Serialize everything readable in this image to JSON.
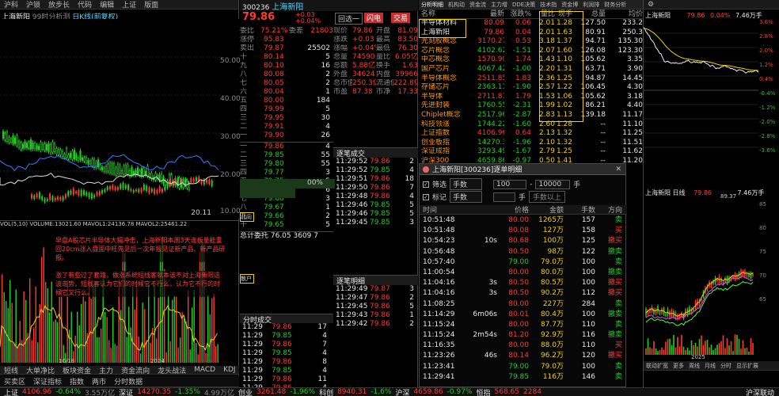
{
  "left": {
    "tabs": [
      "沪科",
      "沪锁",
      "放步长",
      "代码",
      "编辑",
      "上证",
      "版面",
      "买卖区",
      "深证指标",
      "指数",
      "两市",
      "分时数据"
    ],
    "chart_title": "上海新阳",
    "chart_info": "99时分析测",
    "chart_mode": "日K线(前复权)",
    "yaxis": [
      "50.00",
      "40.00",
      "30.00",
      "20.00",
      "10.00"
    ],
    "ma_line": "MA5  MA10  MA20  MA30  MA60",
    "price_low": "20.11",
    "vol_title": "VOL(5,10)  VOLUME:13021.60  MAVOL1:24136.78  MAVOL2:25461.22",
    "note1": "早盘A股芯片半导体大幅冲击，上海新阳本周3天连板量能重回20cm涨入盘面中旺先见后一次年报见证新产品、新产品研报。",
    "note2": "涨了有些过了套路，做涨系统短线客就本该不对上海新阳这波走势，短线客认为它们的时候它不行么，认为它不行的时候它又行么。",
    "bottom_tabs": [
      "短线",
      "大单净比",
      "板块资金",
      "主力",
      "资金流向",
      "龙头战法",
      "MACD",
      "KDJ"
    ],
    "dates": [
      "10/18",
      "2024"
    ]
  },
  "order": {
    "code": "300236",
    "name": "上海新阳",
    "price": "79.86",
    "chg": "+0.03",
    "pct": "+0.04%",
    "btn_1": "回选一",
    "btn_2": "闪电",
    "btn_3": "交易",
    "header": [
      "委比",
      "75.21%",
      "委差",
      "21803"
    ],
    "label_buy": "卖盘",
    "label_sell": "买盘",
    "top": [
      [
        "卖盘",
        "",
        ""
      ],
      [
        "涨停",
        "95.83",
        ""
      ],
      [
        "卖出",
        "79.87",
        "25502"
      ]
    ],
    "asks": [
      [
        "十",
        "80.14",
        "5"
      ],
      [
        "九",
        "80.10",
        "16"
      ],
      [
        "八",
        "80.08",
        "2"
      ],
      [
        "七",
        "80.05",
        "2"
      ],
      [
        "六",
        "80.04",
        "1"
      ],
      [
        "五",
        "80.00",
        "184"
      ],
      [
        "四",
        "79.99",
        "5"
      ],
      [
        "三",
        "79.95",
        "30"
      ],
      [
        "二",
        "79.91",
        "4"
      ],
      [
        "一",
        "79.90",
        "26"
      ]
    ],
    "bids": [
      [
        "一",
        "79.86",
        "4"
      ],
      [
        "二",
        "79.85",
        "55"
      ],
      [
        "三",
        "79.80",
        "55"
      ],
      [
        "四",
        "79.77",
        "3"
      ],
      [
        "五",
        "79.75",
        "5"
      ],
      [
        "六",
        "79.70",
        "6"
      ],
      [
        "七",
        "79.68",
        "3"
      ],
      [
        "八",
        "79.67",
        "1"
      ],
      [
        "九",
        "79.66",
        "2"
      ],
      [
        "十",
        "79.65",
        "5"
      ]
    ],
    "stats": [
      [
        "现价",
        "79.86",
        "开盘",
        "81.09"
      ],
      [
        "涨跌",
        "+0.03",
        "最高",
        "83.50"
      ],
      [
        "涨幅",
        "+0.04%",
        "最低",
        "76.30"
      ],
      [
        "总量",
        "74590",
        "量比",
        "6.05亿"
      ],
      [
        "总额",
        "5.88亿",
        "换手",
        "1.63"
      ],
      [
        "外盘",
        "34624",
        "内盘",
        "39966"
      ],
      [
        "总市值",
        "250.3亿",
        "流通值",
        "222.8亿"
      ],
      [
        "市盈",
        "87.38",
        "市净",
        "17.33"
      ]
    ],
    "pct_mark": "00%",
    "side_marks": [
      "北向",
      "散户",
      "成交",
      "卖盘"
    ],
    "bottom_total": "总计委托 76.05 3609 7",
    "tick_header": "分时成交",
    "ticks": [
      [
        "11:29",
        "79.86",
        "17"
      ],
      [
        "11:29",
        "79.85",
        "4"
      ],
      [
        "11:29",
        "79.86",
        "7"
      ],
      [
        "11:29",
        "79.85",
        "4"
      ],
      [
        "11:29",
        "79.86",
        "8"
      ],
      [
        "11:29",
        "79.85",
        "4"
      ],
      [
        "11:29",
        "79.86",
        "11"
      ],
      [
        "11:29",
        "79.86",
        "4"
      ]
    ],
    "tick_header2": "逐笔成交",
    "ticks2": [
      [
        "11:29:52",
        "79.86",
        "2"
      ],
      [
        "11:29:52",
        "79.85",
        "4"
      ],
      [
        "11:29:51",
        "79.86",
        "18"
      ],
      [
        "11:29:50",
        "79.86",
        "7"
      ],
      [
        "11:29:48",
        "79.86",
        "4"
      ],
      [
        "11:29:46",
        "79.85",
        "5"
      ],
      [
        "11:29:46",
        "79.85",
        "5"
      ],
      [
        "11:29:45",
        "79.85",
        "3"
      ]
    ],
    "tick_header3": "逐笔明细",
    "ticks3": [
      [
        "11:29:49",
        "79.87",
        "3"
      ],
      [
        "11:29:47",
        "79.86",
        "2"
      ],
      [
        "11:29:45",
        "79.86",
        "5"
      ],
      [
        "11:29:43",
        "79.86",
        "1"
      ],
      [
        "11:29:42",
        "79.86",
        "2"
      ]
    ]
  },
  "sector": {
    "tabs": [
      "分析明细",
      "机构动",
      "资金流",
      "主力增",
      "DDE决策",
      "技术指",
      "资金博",
      "利润排",
      "财务分析"
    ],
    "cols": [
      "名称",
      "",
      "最新",
      "涨跌%",
      "量比",
      "现手",
      "总量",
      "均价"
    ],
    "rows": [
      [
        "半导体材料",
        "",
        "80.09",
        "0.06",
        "2.01",
        "1.28",
        "127.50",
        "233.2"
      ],
      [
        "上海新阳",
        "",
        "79.86",
        "0.04",
        "2.01",
        "1.63",
        "80.91",
        "250.3"
      ],
      [
        "光刻胶概念",
        "",
        "3170.27",
        "0.53",
        "3.18",
        "1.37",
        "94.71",
        "135.30"
      ],
      [
        "芯片概念",
        "",
        "4102.62",
        "-1.51",
        "2.07",
        "1.60",
        "126.08",
        "123.30"
      ],
      [
        "中芯概念",
        "",
        "1570.90",
        "1.74",
        "1.43",
        "1.10",
        "105.62",
        "3.35"
      ],
      [
        "国产芯片",
        "",
        "4067.42",
        "-1.00",
        "2.20",
        "1.31",
        "63.71",
        "3.90"
      ],
      [
        "半导体概念",
        "",
        "2511.85",
        "1.83",
        "2.36",
        "1.25",
        "94.87",
        "14.45"
      ],
      [
        "存储芯片",
        "",
        "2363.11",
        "-1.90",
        "2.57",
        "1.22",
        "106.45",
        "4.30"
      ],
      [
        "半导体",
        "",
        "2711.81",
        "1.79",
        "1.53",
        "1.06",
        "105.62",
        "3.18"
      ],
      [
        "先进封装",
        "",
        "1760.55",
        "-2.31",
        "1.99",
        "1.02",
        "86.21",
        "4.40"
      ],
      [
        "Chiplet概念",
        "",
        "2517.96",
        "-2.87",
        "2.83",
        "1.13",
        "139.18",
        "11.17"
      ],
      [
        "科技领涨",
        "",
        "1744.22",
        "-1.60",
        "2.60",
        "1.28",
        "--",
        "11.10"
      ],
      [
        "上证指数",
        "",
        "4106.96",
        "0.64",
        "2.13",
        "1.32",
        "--",
        "11.25"
      ],
      [
        "创业板指",
        "",
        "14270.35",
        "-1.96",
        "2.10",
        "1.32",
        "--",
        "11.51"
      ],
      [
        "深证成指",
        "",
        "3293.49",
        "-1.67",
        "2.79",
        "1.25",
        "--",
        "11.62"
      ],
      [
        "沪深300",
        "",
        "4659.86",
        "-0.97",
        "0.50",
        "1.41",
        "--",
        "11.20"
      ]
    ]
  },
  "detail": {
    "title": "上海新阳[300236]逐单明细",
    "f1_label": "筛选",
    "f1_value": "手数",
    "f1_min": "100",
    "f1_max": "10000",
    "f1_unit": "手",
    "f2_label": "标记",
    "f2_value": "手数",
    "f2_unit": "手",
    "f2_opt": "手数以上",
    "cols": [
      "时间",
      "",
      "价格",
      "金额",
      "手数",
      "方向"
    ],
    "rows": [
      [
        "10:51:48",
        "",
        "80.00",
        "1265万",
        "157",
        "卖"
      ],
      [
        "10:51:48",
        "",
        "80.08",
        "127万",
        "158",
        "买"
      ],
      [
        "10:54:23",
        "10s",
        "80.68",
        "100万",
        "125",
        "撤买"
      ],
      [
        "10:56:48",
        "",
        "80.50",
        "98万",
        "122",
        "撤卖"
      ],
      [
        "10:57:40",
        "",
        "79.00",
        "79.0万",
        "100",
        "卖"
      ],
      [
        "11:00:54",
        "",
        "80.00",
        "80.0万",
        "100",
        "撤卖"
      ],
      [
        "11:04:16",
        "3s",
        "80.50",
        "80.5万",
        "100",
        "撤买"
      ],
      [
        "11:04:16",
        "3s",
        "80.50",
        "90.2万",
        "112",
        "撤买"
      ],
      [
        "11:08:25",
        "",
        "80.00",
        "227万",
        "284",
        "卖"
      ],
      [
        "11:14:29",
        "6m06s",
        "80.01",
        "80.4万",
        "100",
        "撤卖"
      ],
      [
        "11:15:24",
        "",
        "80.00",
        "87.7万",
        "110",
        "卖"
      ],
      [
        "11:15:24",
        "2m54s",
        "81.20",
        "92.9万",
        "116",
        "撤卖"
      ],
      [
        "11:16:35",
        "",
        "80.00",
        "88.0万",
        "110",
        "买"
      ],
      [
        "11:23:26",
        "46s",
        "80.14",
        "96.2万",
        "120",
        "撤买"
      ],
      [
        "11:23:41",
        "",
        "79.00",
        "79.0万",
        "100",
        "卖"
      ],
      [
        "11:29:41",
        "",
        "79.85",
        "116万",
        "146",
        "卖"
      ]
    ]
  },
  "mini": {
    "name": "上海新阳",
    "price": "79.86",
    "pct": "0.04%",
    "vol": "7.46万手",
    "yaxis_right": [
      "3.6%",
      "2.8%",
      "2.0%",
      "1.2%",
      "0.4%",
      "-0.4%",
      "-1.2%",
      "-2.0%",
      "-2.8%",
      "-3.6%"
    ],
    "name2": "上海新阳 日线",
    "price2": "79.86",
    "vol2": "7.46万手",
    "hi_mark": "89.37",
    "yaxis2": [
      "85",
      "80",
      "75",
      "70",
      "65"
    ],
    "bottom_tabs": [
      "联动扩宽",
      "更多",
      "周线",
      "月线",
      "分时",
      "显示扩展"
    ],
    "dates": [
      "2024",
      "2025"
    ]
  },
  "status": [
    [
      "上证",
      "4106.96",
      "-0.64%",
      "",
      "3.55万亿"
    ],
    [
      "深证",
      "14270.35",
      "-1.35%",
      "",
      "4.99万亿"
    ],
    [
      "创业",
      "3261.48",
      "-1.96%",
      "",
      ""
    ],
    [
      "科创",
      "8940.31",
      "-1.6%",
      ""
    ],
    [
      "沪深",
      "4659.86",
      "-0.97%",
      ""
    ],
    [
      "恒指",
      "568.65",
      "2284",
      ""
    ]
  ],
  "status_right": "沪深联动"
}
